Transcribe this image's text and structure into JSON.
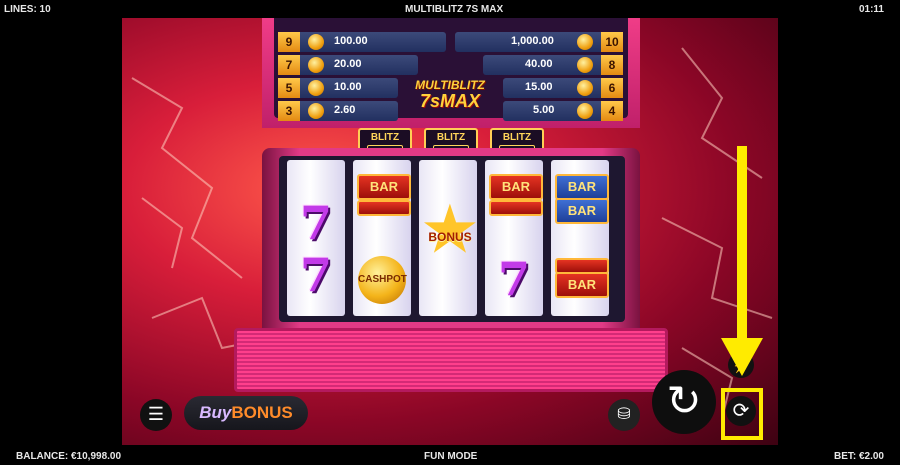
{
  "header": {
    "lines": "LINES: 10",
    "title": "MULTIBLITZ 7S MAX",
    "clock": "01:11"
  },
  "footer": {
    "balance": "BALANCE: €10,998.00",
    "mode": "FUN MODE",
    "bet": "BET: €2.00"
  },
  "paytable": {
    "left": [
      {
        "count": "9",
        "value": "100.00"
      },
      {
        "count": "7",
        "value": "20.00"
      },
      {
        "count": "5",
        "value": "10.00"
      },
      {
        "count": "3",
        "value": "2.60"
      }
    ],
    "right": [
      {
        "count": "10",
        "value": "1,000.00"
      },
      {
        "count": "8",
        "value": "40.00"
      },
      {
        "count": "6",
        "value": "15.00"
      },
      {
        "count": "4",
        "value": "5.00"
      }
    ]
  },
  "logo": {
    "line1": "MULTIBLITZ",
    "line2": "7sMAX"
  },
  "blitz_tabs": [
    "BLITZ",
    "BLITZ",
    "BLITZ"
  ],
  "reels": {
    "bar_label": "BAR",
    "cashpot_label": "CASHPOT",
    "bonus_label": "BONUS",
    "seven_label": "7"
  },
  "controls": {
    "buy_bonus_prefix": "Buy",
    "buy_bonus_suffix": "BONUS",
    "menu_icon": "hamburger-menu-icon",
    "coins_icon": "coin-stack-icon",
    "spin_icon": "spin-arrow-icon",
    "autoplay_icon": "autoplay-cycle-icon"
  },
  "colors": {
    "annotation": "#ffeb00",
    "accent": "#e23a86"
  }
}
